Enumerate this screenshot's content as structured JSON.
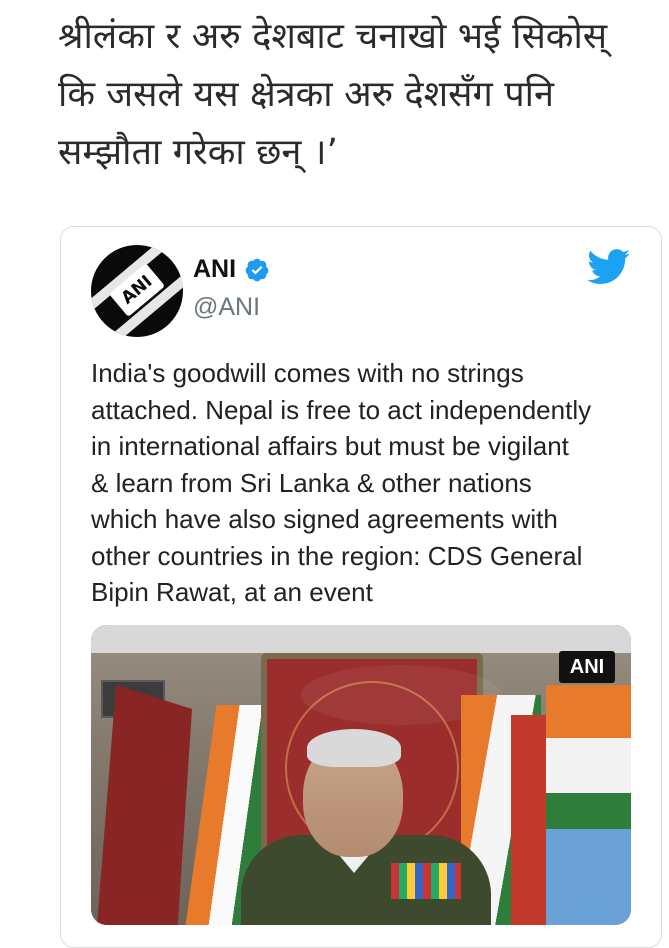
{
  "article": {
    "lines": [
      "श्रीलंका र अरु देशबाट चनाखो भई सिकोस्",
      "कि जसले यस क्षेत्रका अरु देशसँग पनि",
      "सम्झौता गरेका छन् ।’"
    ]
  },
  "tweet": {
    "author_name": "ANI",
    "handle": "@ANI",
    "text_lines": [
      "India's goodwill comes with no strings",
      "attached. Nepal is free to act independently",
      "in international affairs but must be vigilant",
      "& learn from Sri Lanka & other nations",
      "which have also signed agreements with",
      "other countries in the region: CDS General",
      "Bipin Rawat, at an event"
    ],
    "media_watermark": "ANI",
    "avatar_logo": "ANI",
    "colors": {
      "twitter_blue": "#1da1f2",
      "verified_blue": "#1d9bf0"
    }
  }
}
